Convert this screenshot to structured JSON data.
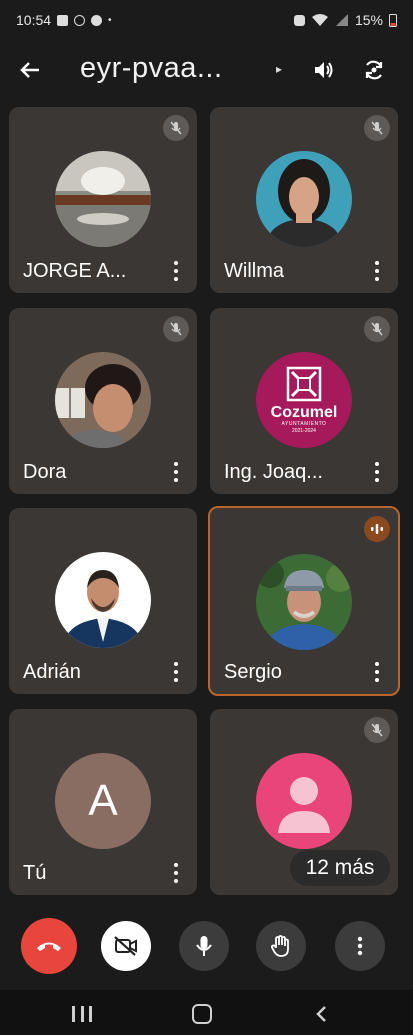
{
  "status_bar": {
    "time": "10:54",
    "battery": "15%"
  },
  "header": {
    "title": "eyr-pvaa..."
  },
  "participants": [
    {
      "name": "JORGE A...",
      "avatar": "photo",
      "muted": true
    },
    {
      "name": "Willma",
      "avatar": "photo",
      "muted": true
    },
    {
      "name": "Dora",
      "avatar": "photo",
      "muted": true
    },
    {
      "name": "Ing. Joaq...",
      "avatar": "logo",
      "muted": true
    },
    {
      "name": "Adrián",
      "avatar": "photo",
      "muted": false
    },
    {
      "name": "Sergio",
      "avatar": "photo",
      "muted": false,
      "speaking": true
    },
    {
      "name": "Tú",
      "avatar": "initial",
      "initial": "A",
      "muted": false
    },
    {
      "name": "",
      "avatar": "default",
      "muted": true
    }
  ],
  "logo_tile": {
    "brand": "Cozumel",
    "sub1": "AYUNTAMIENTO",
    "sub2": "2021-2024"
  },
  "more_participants": "12 más",
  "controls": [
    "end-call",
    "camera-off",
    "microphone",
    "raise-hand",
    "more-options"
  ],
  "colors": {
    "background": "#1b1b1b",
    "tile": "#3b3734",
    "end_call": "#e8453c",
    "speaking_border": "#b8652a",
    "brand_magenta": "#a6195a"
  }
}
